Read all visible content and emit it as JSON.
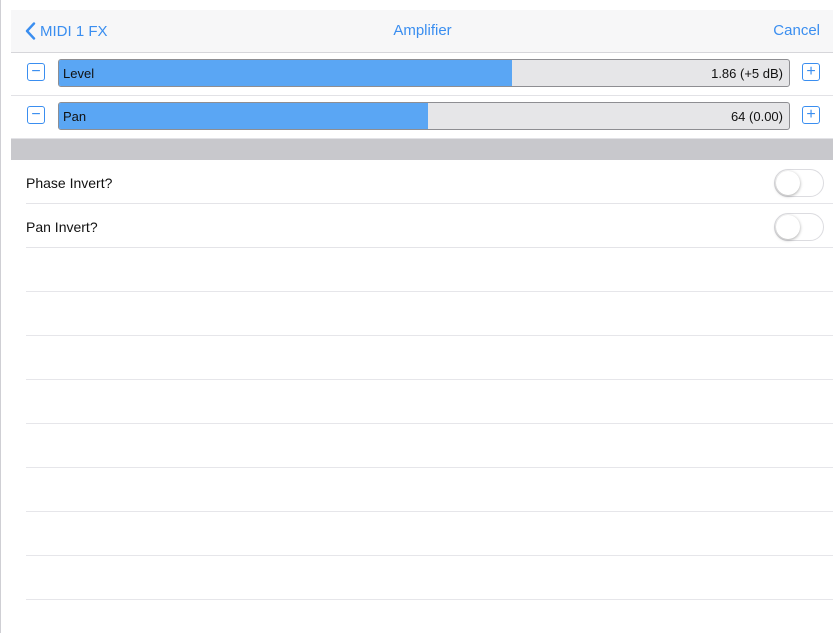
{
  "nav": {
    "back_label": "MIDI 1 FX",
    "title": "Amplifier",
    "cancel_label": "Cancel"
  },
  "sliders": [
    {
      "label": "Level",
      "value_text": "1.86 (+5 dB)",
      "fill_fraction": 0.62
    },
    {
      "label": "Pan",
      "value_text": "64 (0.00)",
      "fill_fraction": 0.505
    }
  ],
  "toggles": [
    {
      "label": "Phase Invert?",
      "on": false
    },
    {
      "label": "Pan Invert?",
      "on": false
    }
  ],
  "icons": {
    "back": "chevron-left-icon",
    "decrement": "minus-icon",
    "increment": "plus-icon"
  },
  "colors": {
    "accent": "#3a8ef0",
    "slider_fill": "#5aa6f4",
    "section_separator": "#c8c8cc"
  }
}
